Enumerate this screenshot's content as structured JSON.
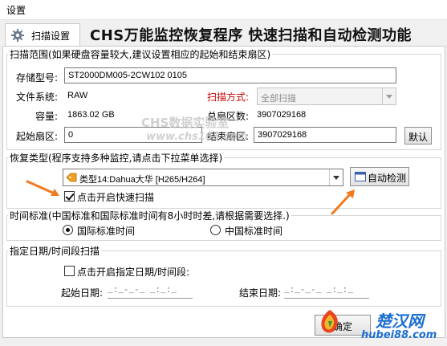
{
  "window": {
    "title": "设置"
  },
  "tab": {
    "label": "扫描设置",
    "icon": "gear-icon"
  },
  "banner": "CHS万能监控恢复程序 快速扫描和自动检测功能",
  "scan_range": {
    "legend": "扫描范围(如果硬盘容量较大,建议设置相应的起始和结束扇区)",
    "storage_model_label": "存储型号:",
    "storage_model_value": "ST2000DM005-2CW102      0105",
    "filesystem_label": "文件系统:",
    "filesystem_value": "RAW",
    "scan_method_label": "扫描方式:",
    "scan_method_value": "全部扫描",
    "capacity_label": "容量:",
    "capacity_value": "1863.02 GB",
    "total_sectors_label": "总扇区数:",
    "total_sectors_value": "3907029168",
    "start_sector_label": "起始扇区:",
    "start_sector_value": "0",
    "end_sector_label": "结束扇区:",
    "end_sector_value": "3907029168",
    "default_button": "默认"
  },
  "recovery_type": {
    "legend": "恢复类型(程序支持多种监控,请点击下拉菜单选择)",
    "selected": "类型14:Dahua大华 [H265/H264]",
    "auto_detect_button": "自动检测",
    "quick_scan_label": "点击开启快速扫描",
    "quick_scan_checked": true
  },
  "time_standard": {
    "legend": "时间标准(中国标准和国际标准时间有8小时时差,请根据需要选择.)",
    "option_international": "国际标准时间",
    "option_china": "中国标准时间",
    "selected": "international"
  },
  "date_scan": {
    "legend": "指定日期/时间段扫描",
    "enable_label": "点击开启指定日期/时间段:",
    "enable_checked": false,
    "start_date_label": "起始日期:",
    "start_date_mask": "_:_-_-_ _:_:_",
    "end_date_label": "结束日期:",
    "end_date_mask": "_:_-_-_ _:_:_"
  },
  "watermarks": {
    "center_cn": "CHS数据实验室",
    "center_url": "www.chs163.com",
    "corner_cn": "楚汉网",
    "corner_url": "hubei88.com",
    "partial_button": "确定"
  },
  "colors": {
    "accent_red": "#cc0000",
    "arrow_orange": "#f07a1f",
    "tag_icon": "#f0a020"
  }
}
